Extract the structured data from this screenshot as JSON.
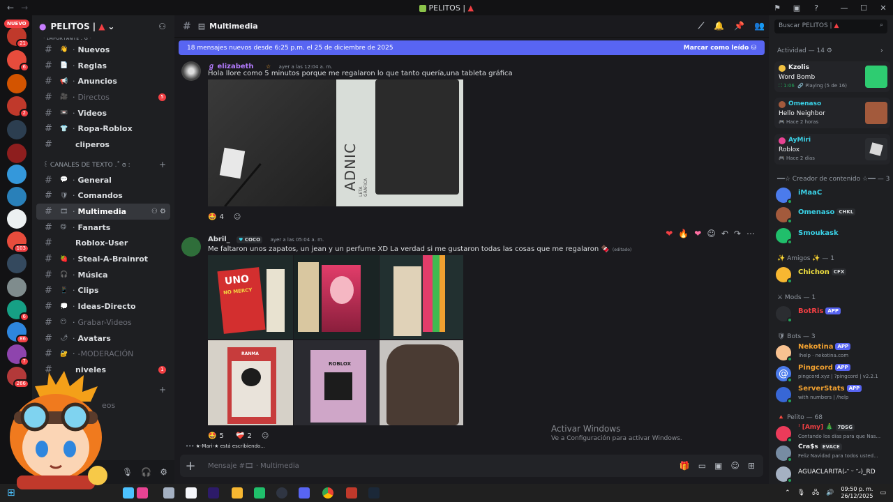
{
  "window": {
    "title": "PELITOS |",
    "title_icon": "server-icon"
  },
  "rail": {
    "nuevo_label": "NUEVO",
    "badges": [
      "21",
      "6",
      "2",
      "1",
      "103",
      "1",
      "1",
      "6",
      "86",
      "7",
      "266"
    ]
  },
  "server": {
    "name": "PELITOS |",
    "partial_category": "· ɪᴍᴘᴏʀᴛᴀɴᴛᴇ . ɞ ·"
  },
  "channels": [
    {
      "emoji": "👋",
      "label": "Nuevos",
      "dim": false
    },
    {
      "emoji": "📄",
      "label": "Reglas",
      "dim": false
    },
    {
      "emoji": "📢",
      "label": "Anuncios",
      "dim": false
    },
    {
      "emoji": "🎥",
      "label": "Directos",
      "dim": true,
      "badge": "5"
    },
    {
      "emoji": "📼",
      "label": "Videos",
      "dim": false
    },
    {
      "emoji": "👕",
      "label": "Ropa-Roblox",
      "dim": false
    },
    {
      "emoji": "",
      "label": "cliperos",
      "dim": false
    }
  ],
  "category_text": "꒰ CANALES DE TEXTO .˚ ɞ :",
  "text_channels": [
    {
      "emoji": "💬",
      "label": "General",
      "dim": false
    },
    {
      "emoji": "🛡",
      "label": "Comandos",
      "dim": false
    },
    {
      "emoji": "🎞",
      "label": "Multimedia",
      "dim": false,
      "active": true
    },
    {
      "emoji": "😋",
      "label": "Fanarts",
      "dim": false
    },
    {
      "emoji": "",
      "label": "Roblox-User",
      "dim": false
    },
    {
      "emoji": "🍓",
      "label": "Steal-A-Brainrot",
      "dim": false
    },
    {
      "emoji": "🎧",
      "label": "Música",
      "dim": false
    },
    {
      "emoji": "📱",
      "label": "Clips",
      "dim": false
    },
    {
      "emoji": "💭",
      "label": "Ideas-Directo",
      "dim": false
    },
    {
      "emoji": "😶",
      "label": "Grabar-Videos",
      "dim": true
    },
    {
      "emoji": "🌶",
      "label": "Avatars",
      "dim": false
    },
    {
      "emoji": "🔐",
      "label": "-MODERACIÓN",
      "dim": true
    },
    {
      "emoji": "",
      "label": "niveles",
      "dim": false,
      "badge": "1"
    }
  ],
  "hidden_partial": "eos",
  "main": {
    "channel_name": "Multimedia",
    "new_messages": "18 mensajes nuevos desde 6:25 p.m. el 25 de diciembre de 2025",
    "mark_read": "Marcar como leído",
    "messages": [
      {
        "author": "elizabeth",
        "author_prefix": "ℊ",
        "author_color": "#b47bff",
        "time": "ayer a las 12:04 a. m.",
        "text": "Hola llore como 5 minutos porque me regalaron lo que tanto quería,una tableta gráfica",
        "reactions": [
          {
            "emoji": "🤩",
            "count": "4"
          }
        ],
        "tablet_brand": "ADNIC",
        "tablet_small": "LETA GRÁFICA"
      },
      {
        "author": "Abril_",
        "author_color": "#dbdee1",
        "tag": "COCO",
        "time": "ayer a las 05:04 a. m.",
        "text": "Me faltaron unos zapatos, un jean y un perfume XD La verdad si me gustaron todas las cosas que me regalaron 🍫",
        "edited": "(editado)",
        "reactions": [
          {
            "emoji": "🤩",
            "count": "5"
          },
          {
            "emoji": "❤️‍🩹",
            "count": "2"
          }
        ],
        "uno_text": "UNO",
        "uno_sub": "NO MERCY",
        "roblox_text": "ROBLOX",
        "ranma_text": "RANMA"
      }
    ],
    "typing": "★-Mari-★ está escribiendo...",
    "composer_placeholder": "Mensaje #🎞 · Multimedia"
  },
  "watermark": {
    "title": "Activar Windows",
    "sub": "Ve a Configuración para activar Windows."
  },
  "members": {
    "search_placeholder": "Buscar PELITOS |",
    "activity_header": "Actividad — 14",
    "activity": [
      {
        "name": "Kzolis",
        "name_color": "#f2f3f5",
        "game": "Word Bomb",
        "meta": "1:06",
        "meta2": "Playing (5 de 16)",
        "art_color": "#2ecc71"
      },
      {
        "name": "Omenaso",
        "name_color": "#3ad1e6",
        "game": "Hello Neighbor",
        "meta": "Hace 2 horas",
        "meta2": "",
        "art_color": "#a35a3c"
      },
      {
        "name": "AyMiri",
        "name_color": "#3ad1e6",
        "game": "Roblox",
        "meta": "Hace 2 días",
        "meta2": "",
        "art_color": "#d9d9d9"
      }
    ],
    "groups": [
      {
        "header": "━━☆ Creador de contenido ☆━━ — 3"
      },
      {
        "header": "✨ Amigos ✨ — 1"
      },
      {
        "header": "⚔ Mods — 1"
      },
      {
        "header": "🛡 Bots — 3"
      },
      {
        "header": "🔺 Pelito — 68"
      }
    ],
    "creators": [
      {
        "name": "iMaaC",
        "color": "#3ad1e6"
      },
      {
        "name": "Omenaso",
        "color": "#3ad1e6",
        "tag": "CHKL"
      },
      {
        "name": "Smoukask",
        "color": "#3ad1e6"
      }
    ],
    "friends": [
      {
        "name": "Chichon",
        "color": "#f0e040",
        "tag": "CFX"
      }
    ],
    "mods": [
      {
        "name": "BotRis",
        "color": "#f23f43",
        "tag": "APP"
      }
    ],
    "bots": [
      {
        "name": "Nekotina",
        "color": "#f0a030",
        "tag": "APP",
        "status": "!help · nekotina.com"
      },
      {
        "name": "Pingcord",
        "color": "#f0a030",
        "tag": "APP",
        "status": "pingcord.xyz | ?pingcord | v2.2.1"
      },
      {
        "name": "ServerStats",
        "color": "#f0a030",
        "tag": "APP",
        "status": "with numbers | /help"
      }
    ],
    "pelitos": [
      {
        "name": "ꜝ [Amy] 🎄",
        "color": "#f23f43",
        "tag": "7DSG",
        "status": "Contando los días para que Nas..."
      },
      {
        "name": "Cra$s",
        "color": "#f2f3f5",
        "tag": "EVACE",
        "status": "Feliz Navidad para todos usted..."
      },
      {
        "name": "AGUACLARITA(˶ᵔ ᵕ ᵔ˶)_RD",
        "color": "#f2f3f5",
        "status": ""
      }
    ]
  },
  "taskbar": {
    "time": "09:50 p. m.",
    "date": "26/12/2025"
  },
  "colors": {
    "accent": "#5865f2",
    "danger": "#f23f43",
    "online": "#23a55a"
  }
}
